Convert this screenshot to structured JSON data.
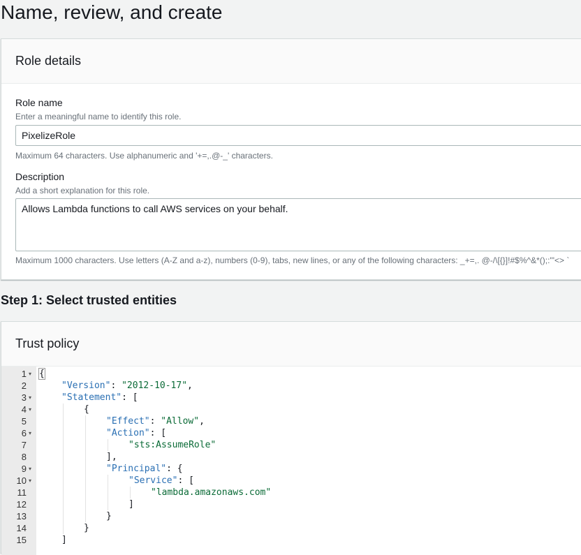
{
  "page": {
    "title": "Name, review, and create"
  },
  "role_details": {
    "title": "Role details",
    "role_name": {
      "label": "Role name",
      "description": "Enter a meaningful name to identify this role.",
      "value": "PixelizeRole",
      "constraint": "Maximum 64 characters. Use alphanumeric and '+=,.@-_' characters."
    },
    "description": {
      "label": "Description",
      "description": "Add a short explanation for this role.",
      "value": "Allows Lambda functions to call AWS services on your behalf.",
      "constraint": "Maximum 1000 characters. Use letters (A-Z and a-z), numbers (0-9), tabs, new lines, or any of the following characters: _+=,. @-/\\[{}]!#$%^&*();:\"'<> `"
    }
  },
  "step1": {
    "heading": "Step 1: Select trusted entities"
  },
  "trust_policy": {
    "title": "Trust policy",
    "lines": [
      {
        "num": "1",
        "fold": true,
        "indent": 0,
        "tokens": [
          {
            "t": "punc",
            "v": "{"
          }
        ]
      },
      {
        "num": "2",
        "fold": false,
        "indent": 1,
        "tokens": [
          {
            "t": "key",
            "v": "\"Version\""
          },
          {
            "t": "punc",
            "v": ": "
          },
          {
            "t": "str",
            "v": "\"2012-10-17\""
          },
          {
            "t": "punc",
            "v": ","
          }
        ]
      },
      {
        "num": "3",
        "fold": true,
        "indent": 1,
        "tokens": [
          {
            "t": "key",
            "v": "\"Statement\""
          },
          {
            "t": "punc",
            "v": ": ["
          }
        ]
      },
      {
        "num": "4",
        "fold": true,
        "indent": 2,
        "tokens": [
          {
            "t": "punc",
            "v": "{"
          }
        ]
      },
      {
        "num": "5",
        "fold": false,
        "indent": 3,
        "tokens": [
          {
            "t": "key",
            "v": "\"Effect\""
          },
          {
            "t": "punc",
            "v": ": "
          },
          {
            "t": "str",
            "v": "\"Allow\""
          },
          {
            "t": "punc",
            "v": ","
          }
        ]
      },
      {
        "num": "6",
        "fold": true,
        "indent": 3,
        "tokens": [
          {
            "t": "key",
            "v": "\"Action\""
          },
          {
            "t": "punc",
            "v": ": ["
          }
        ]
      },
      {
        "num": "7",
        "fold": false,
        "indent": 4,
        "tokens": [
          {
            "t": "str",
            "v": "\"sts:AssumeRole\""
          }
        ]
      },
      {
        "num": "8",
        "fold": false,
        "indent": 3,
        "tokens": [
          {
            "t": "punc",
            "v": "],"
          }
        ]
      },
      {
        "num": "9",
        "fold": true,
        "indent": 3,
        "tokens": [
          {
            "t": "key",
            "v": "\"Principal\""
          },
          {
            "t": "punc",
            "v": ": {"
          }
        ]
      },
      {
        "num": "10",
        "fold": true,
        "indent": 4,
        "tokens": [
          {
            "t": "key",
            "v": "\"Service\""
          },
          {
            "t": "punc",
            "v": ": ["
          }
        ]
      },
      {
        "num": "11",
        "fold": false,
        "indent": 5,
        "tokens": [
          {
            "t": "str",
            "v": "\"lambda.amazonaws.com\""
          }
        ]
      },
      {
        "num": "12",
        "fold": false,
        "indent": 4,
        "tokens": [
          {
            "t": "punc",
            "v": "]"
          }
        ]
      },
      {
        "num": "13",
        "fold": false,
        "indent": 3,
        "tokens": [
          {
            "t": "punc",
            "v": "}"
          }
        ]
      },
      {
        "num": "14",
        "fold": false,
        "indent": 2,
        "tokens": [
          {
            "t": "punc",
            "v": "}"
          }
        ]
      },
      {
        "num": "15",
        "fold": false,
        "indent": 1,
        "tokens": [
          {
            "t": "punc",
            "v": "]"
          }
        ]
      }
    ]
  },
  "colors": {
    "page_bg": "#f2f3f3",
    "json_key": "#2a6fb3",
    "json_string": "#0b6b37",
    "gutter_bg": "#ebebeb"
  },
  "icons": {
    "fold_marker": "chevron-down-icon"
  }
}
